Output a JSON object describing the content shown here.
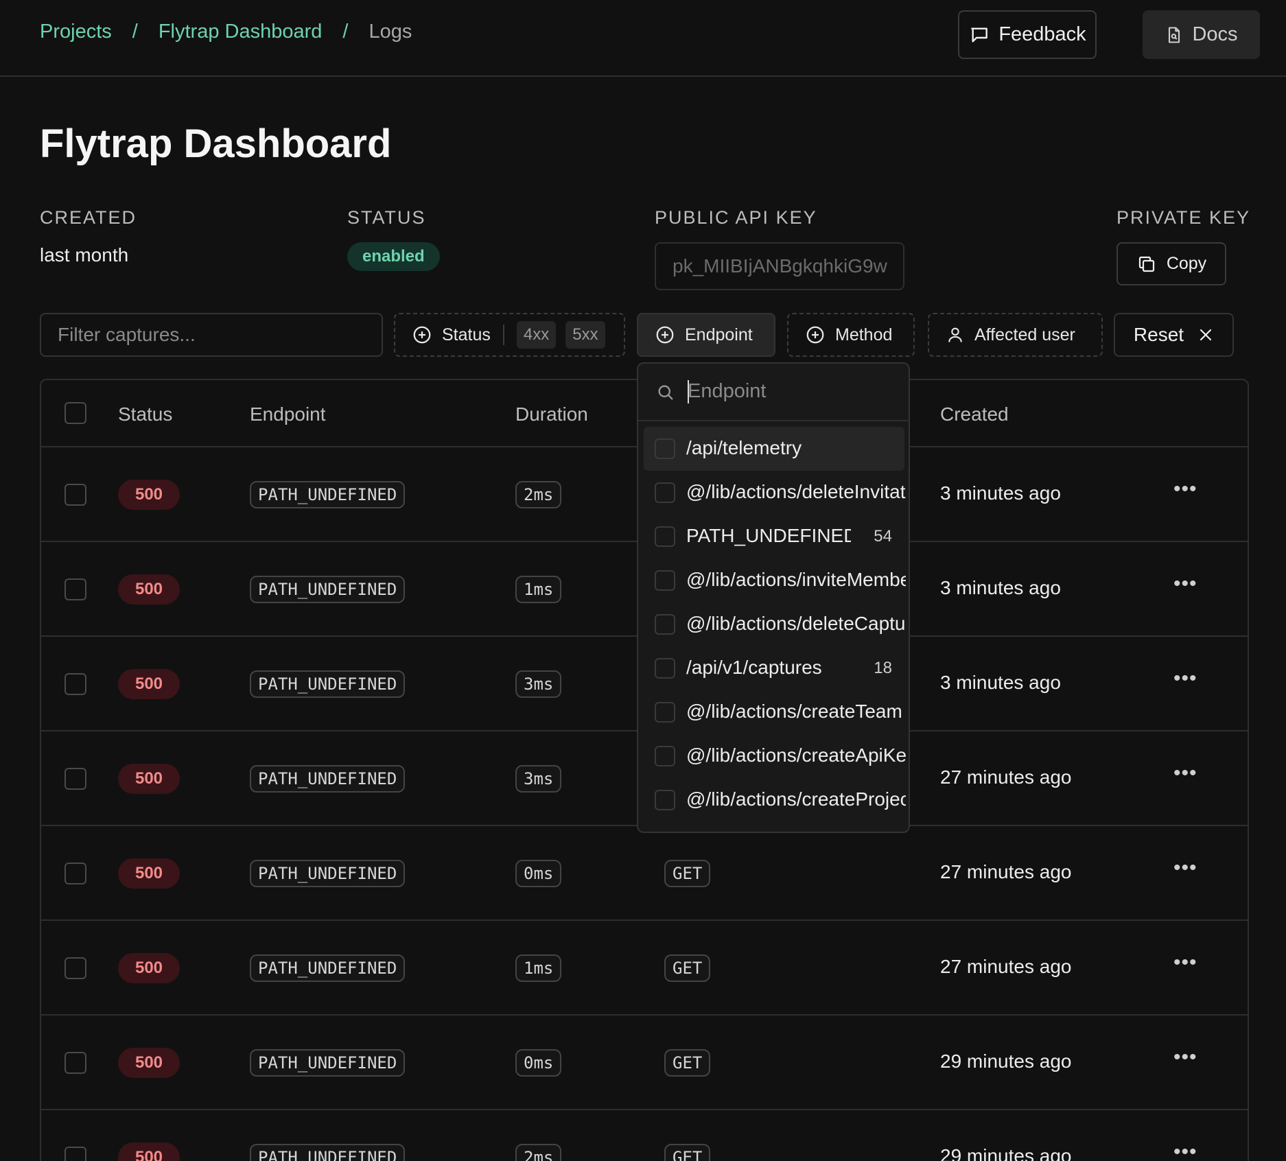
{
  "breadcrumb": {
    "items": [
      "Projects",
      "Flytrap Dashboard",
      "Logs"
    ],
    "separator": "/"
  },
  "header": {
    "feedback_label": "Feedback",
    "docs_label": "Docs"
  },
  "page": {
    "title": "Flytrap Dashboard"
  },
  "meta": {
    "created_label": "CREATED",
    "created_value": "last month",
    "status_label": "STATUS",
    "status_value": "enabled",
    "public_key_label": "PUBLIC API KEY",
    "public_key_value": "pk_MIIBIjANBgkqhkiG9w",
    "private_key_label": "PRIVATE KEY",
    "copy_label": "Copy"
  },
  "filters": {
    "search_placeholder": "Filter captures...",
    "status_label": "Status",
    "status_tags": [
      "4xx",
      "5xx"
    ],
    "endpoint_label": "Endpoint",
    "method_label": "Method",
    "user_label": "Affected user",
    "reset_label": "Reset"
  },
  "table": {
    "columns": [
      "Status",
      "Endpoint",
      "Duration",
      "Created"
    ],
    "rows": [
      {
        "status": "500",
        "endpoint": "PATH_UNDEFINED",
        "duration": "2ms",
        "method": "",
        "created": "3 minutes ago"
      },
      {
        "status": "500",
        "endpoint": "PATH_UNDEFINED",
        "duration": "1ms",
        "method": "",
        "created": "3 minutes ago"
      },
      {
        "status": "500",
        "endpoint": "PATH_UNDEFINED",
        "duration": "3ms",
        "method": "",
        "created": "3 minutes ago"
      },
      {
        "status": "500",
        "endpoint": "PATH_UNDEFINED",
        "duration": "3ms",
        "method": "",
        "created": "27 minutes ago"
      },
      {
        "status": "500",
        "endpoint": "PATH_UNDEFINED",
        "duration": "0ms",
        "method": "GET",
        "created": "27 minutes ago"
      },
      {
        "status": "500",
        "endpoint": "PATH_UNDEFINED",
        "duration": "1ms",
        "method": "GET",
        "created": "27 minutes ago"
      },
      {
        "status": "500",
        "endpoint": "PATH_UNDEFINED",
        "duration": "0ms",
        "method": "GET",
        "created": "29 minutes ago"
      },
      {
        "status": "500",
        "endpoint": "PATH_UNDEFINED",
        "duration": "2ms",
        "method": "GET",
        "created": "29 minutes ago"
      }
    ]
  },
  "dropdown": {
    "search_placeholder": "Endpoint",
    "options": [
      {
        "label": "/api/telemetry",
        "count": ""
      },
      {
        "label": "@/lib/actions/deleteInvitation",
        "count": ""
      },
      {
        "label": "PATH_UNDEFINED",
        "count": "54"
      },
      {
        "label": "@/lib/actions/inviteMember",
        "count": ""
      },
      {
        "label": "@/lib/actions/deleteCapture",
        "count": ""
      },
      {
        "label": "/api/v1/captures",
        "count": "18"
      },
      {
        "label": "@/lib/actions/createTeam",
        "count": ""
      },
      {
        "label": "@/lib/actions/createApiKey",
        "count": ""
      },
      {
        "label": "@/lib/actions/createProject",
        "count": ""
      }
    ]
  },
  "colors": {
    "accent": "#6fd3ad",
    "error": "#f28b8b",
    "background": "#111111"
  }
}
